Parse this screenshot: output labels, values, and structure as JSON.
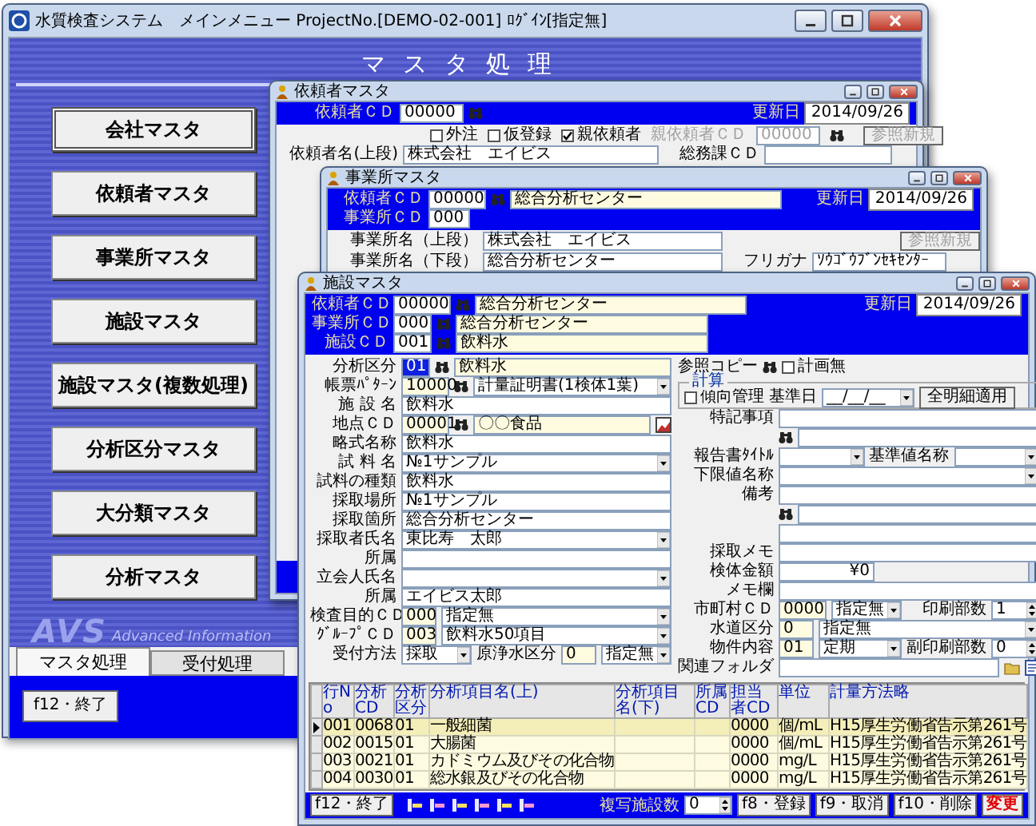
{
  "main_window": {
    "title": "水質検査システム　メインメニュー ProjectNo.[DEMO-02-001] ﾛｸﾞｲﾝ[指定無]",
    "header": "マスタ処理",
    "menu_buttons": [
      {
        "label": "会社マスタ",
        "selected": true
      },
      {
        "label": "依頼者マスタ",
        "selected": false
      },
      {
        "label": "事業所マスタ",
        "selected": false
      },
      {
        "label": "施設マスタ",
        "selected": false
      },
      {
        "label": "施設マスタ(複数処理)",
        "selected": false
      },
      {
        "label": "分析区分マスタ",
        "selected": false
      },
      {
        "label": "大分類マスタ",
        "selected": false
      },
      {
        "label": "分析マスタ",
        "selected": false
      }
    ],
    "logo_mark": "AVS",
    "logo_text": "Advanced Information",
    "tabs": [
      {
        "label": "マスタ処理",
        "selected": true
      },
      {
        "label": "受付処理",
        "selected": false
      }
    ],
    "exit_button": "f12・終了"
  },
  "client_window": {
    "title": "依頼者マスタ",
    "code_label": "依頼者ＣＤ",
    "code": "00000",
    "date_label": "更新日",
    "date": "2014/09/26",
    "checks": [
      {
        "label": "外注",
        "checked": false
      },
      {
        "label": "仮登録",
        "checked": false
      },
      {
        "label": "親依頼者",
        "checked": true
      }
    ],
    "parent_label": "親依頼者ＣＤ",
    "parent_code": "00000",
    "ref_button": "参照新規",
    "name_label": "依頼者名(上段)",
    "name": "株式会社　エイビス",
    "dept_label": "総務課ＣＤ"
  },
  "office_window": {
    "title": "事業所マスタ",
    "date_label": "更新日",
    "date": "2014/09/26",
    "ref_button": "参照新規",
    "header_rows": [
      {
        "label": "依頼者ＣＤ",
        "code": "00000",
        "name": "総合分析センター"
      },
      {
        "label": "事業所ＣＤ",
        "code": "000"
      }
    ],
    "fields": [
      {
        "label": "事業所名（上段）",
        "value": "株式会社　エイビス"
      },
      {
        "label": "事業所名（下段）",
        "value": "総合分析センター",
        "extra_label": "フリガナ",
        "extra_value": "ｿｳｺﾞｳﾌﾞﾝｾｷｾﾝﾀｰ"
      }
    ]
  },
  "facility_window": {
    "title": "施設マスタ",
    "date_label": "更新日",
    "date": "2014/09/26",
    "header_rows": [
      {
        "label": "依頼者ＣＤ",
        "code": "00000",
        "name": "総合分析センター"
      },
      {
        "label": "事業所ＣＤ",
        "code": "000",
        "name": "総合分析センター"
      },
      {
        "label": "施設ＣＤ",
        "code": "001",
        "name": "飲料水"
      }
    ],
    "class_row": {
      "label": "分析区分",
      "code": "01",
      "focused": true,
      "name": "飲料水"
    },
    "copy_label": "参照コピー",
    "plan_check": {
      "label": "計画無",
      "checked": false
    },
    "calc_group": {
      "title": "計算",
      "trend_check": {
        "label": "傾向管理",
        "checked": false
      },
      "base_label": "基準日",
      "base_value": "__/__/__",
      "apply_button": "全明細適用"
    },
    "left_fields": [
      {
        "label": "帳票ﾊﾟﾀｰﾝ",
        "code": "10000",
        "value": "計量証明書(1検体1葉)",
        "kind": "select",
        "search": true
      },
      {
        "label": "施 設 名",
        "value": "飲料水",
        "kind": "input",
        "search": false
      },
      {
        "label": "地点ＣＤ",
        "code": "00001",
        "value": "〇〇食品",
        "kind": "picker",
        "search": true
      },
      {
        "label": "略式名称",
        "value": "飲料水",
        "kind": "input",
        "search": false
      },
      {
        "label": "試 料 名",
        "value": "№1サンプル",
        "kind": "select",
        "search": false
      },
      {
        "label": "試料の種類",
        "value": "飲料水",
        "kind": "input",
        "search": false
      },
      {
        "label": "採取場所",
        "value": "№1サンプル",
        "kind": "input",
        "search": false
      },
      {
        "label": "採取箇所",
        "value": "総合分析センター",
        "kind": "input",
        "search": false
      },
      {
        "label": "採取者氏名",
        "value": "東比寿　太郎",
        "kind": "select",
        "search": false
      },
      {
        "label": "所属",
        "kind": "input",
        "search": false
      },
      {
        "label": "立会人氏名",
        "kind": "select",
        "search": false
      },
      {
        "label": "所属",
        "value": "エイビス太郎",
        "kind": "input",
        "search": false
      },
      {
        "label": "検査目的ＣＤ",
        "code": "000",
        "value": "指定無",
        "kind": "select",
        "search": false
      },
      {
        "label": "ｸﾞﾙｰﾌﾟＣＤ",
        "code": "003",
        "value": "飲料水50項目",
        "kind": "select",
        "search": false
      },
      {
        "label": "受付方法",
        "value": "採取",
        "kind": "select",
        "search": false,
        "extra": {
          "label": "原浄水区分",
          "code": "0",
          "value": "指定無",
          "kind": "select"
        }
      }
    ],
    "right_fields": [
      {
        "label": "特記事項",
        "kind": "input",
        "search": false
      },
      {
        "kind": "input",
        "search": true
      },
      {
        "label": "報告書ﾀｲﾄﾙ",
        "kind": "select",
        "search": false,
        "extra": {
          "label": "基準値名称",
          "kind": "select"
        }
      },
      {
        "label": "下限値名称",
        "kind": "select",
        "search": false
      },
      {
        "label": "備考",
        "kind": "input",
        "search": false
      },
      {
        "kind": "input",
        "search": true
      },
      {
        "kind": "input",
        "search": false
      },
      {
        "label": "採取メモ",
        "kind": "input",
        "search": false
      },
      {
        "label": "検体金額",
        "value": "¥0",
        "kind": "amount",
        "search": false
      },
      {
        "label": "メモ欄",
        "kind": "input",
        "search": false
      },
      {
        "label": "市町村ＣＤ",
        "code": "0000",
        "value": "指定無",
        "kind": "select",
        "search": false,
        "extra": {
          "label": "印刷部数",
          "value": "1",
          "kind": "spin"
        }
      },
      {
        "label": "水道区分",
        "code": "0",
        "value": "指定無",
        "kind": "select",
        "search": false
      },
      {
        "label": "物件内容",
        "code": "01",
        "value": "定期",
        "kind": "select",
        "search": false,
        "extra": {
          "label": "副印刷部数",
          "value": "0",
          "kind": "spin"
        }
      },
      {
        "label": "関連フォルダ",
        "kind": "folder",
        "search": false
      }
    ],
    "table": {
      "columns": [
        "行No",
        "分析CD",
        "分析区分",
        "分析項目名(上)",
        "分析項目名(下)",
        "所属CD",
        "担当者CD",
        "単位",
        "計量方法略"
      ],
      "rows": [
        {
          "cells": [
            "001",
            "0068",
            "01",
            "一般細菌",
            "",
            "",
            "0000",
            "個/mL",
            "H15厚生労働省告示第261号"
          ],
          "selected": true
        },
        {
          "cells": [
            "002",
            "0015",
            "01",
            "大腸菌",
            "",
            "",
            "0000",
            "個/mL",
            "H15厚生労働省告示第261号"
          ],
          "selected": false
        },
        {
          "cells": [
            "003",
            "0021",
            "01",
            "カドミウム及びその化合物",
            "",
            "",
            "0000",
            "mg/L",
            "H15厚生労働省告示第261号"
          ],
          "selected": false
        },
        {
          "cells": [
            "004",
            "0030",
            "01",
            "総水銀及びその化合物",
            "",
            "",
            "0000",
            "mg/L",
            "H15厚生労働省告示第261号"
          ],
          "selected": false
        }
      ]
    },
    "exit_button": "f12・終了",
    "copies_label": "複写施設数",
    "copies_value": "0",
    "action_buttons": [
      "f8・登録",
      "f9・取消",
      "f10・削除"
    ],
    "mode": "変更"
  }
}
